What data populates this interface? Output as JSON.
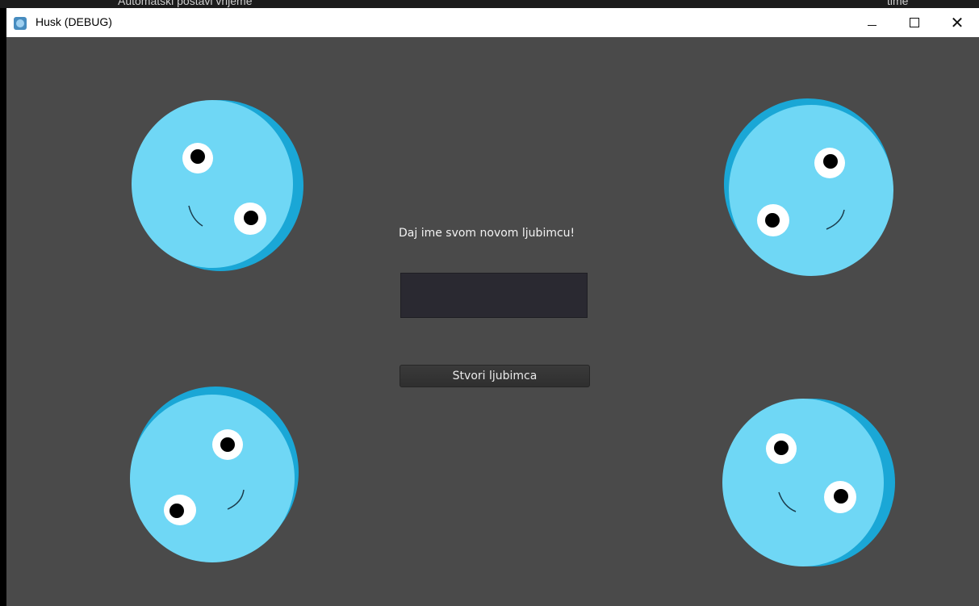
{
  "background": {
    "left_text": "Automatski postavi vrijeme",
    "right_text": "time"
  },
  "window": {
    "title": "Husk (DEBUG)",
    "app_icon": "godot-engine-icon",
    "controls": {
      "minimize": "minimize-icon",
      "maximize": "maximize-icon",
      "close": "close-icon"
    }
  },
  "main": {
    "prompt": "Daj ime svom novom ljubimcu!",
    "name_input": {
      "value": "",
      "placeholder": ""
    },
    "create_button": "Stvori ljubimca"
  },
  "colors": {
    "background": "#4a4a4a",
    "pet_body": "#6fd7f5",
    "pet_shade": "#1aa7d6",
    "input_bg": "#2a2931",
    "button_bg": "#333333"
  }
}
